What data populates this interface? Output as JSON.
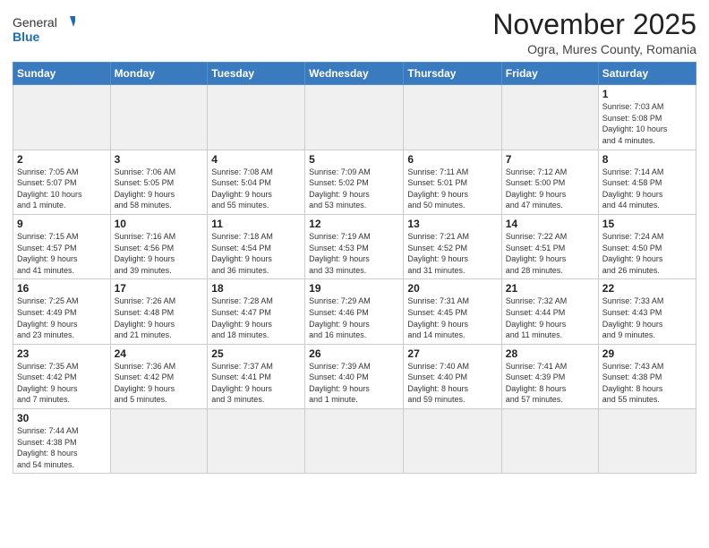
{
  "header": {
    "logo_general": "General",
    "logo_blue": "Blue",
    "title": "November 2025",
    "subtitle": "Ogra, Mures County, Romania"
  },
  "weekdays": [
    "Sunday",
    "Monday",
    "Tuesday",
    "Wednesday",
    "Thursday",
    "Friday",
    "Saturday"
  ],
  "weeks": [
    [
      {
        "num": "",
        "info": ""
      },
      {
        "num": "",
        "info": ""
      },
      {
        "num": "",
        "info": ""
      },
      {
        "num": "",
        "info": ""
      },
      {
        "num": "",
        "info": ""
      },
      {
        "num": "",
        "info": ""
      },
      {
        "num": "1",
        "info": "Sunrise: 7:03 AM\nSunset: 5:08 PM\nDaylight: 10 hours\nand 4 minutes."
      }
    ],
    [
      {
        "num": "2",
        "info": "Sunrise: 7:05 AM\nSunset: 5:07 PM\nDaylight: 10 hours\nand 1 minute."
      },
      {
        "num": "3",
        "info": "Sunrise: 7:06 AM\nSunset: 5:05 PM\nDaylight: 9 hours\nand 58 minutes."
      },
      {
        "num": "4",
        "info": "Sunrise: 7:08 AM\nSunset: 5:04 PM\nDaylight: 9 hours\nand 55 minutes."
      },
      {
        "num": "5",
        "info": "Sunrise: 7:09 AM\nSunset: 5:02 PM\nDaylight: 9 hours\nand 53 minutes."
      },
      {
        "num": "6",
        "info": "Sunrise: 7:11 AM\nSunset: 5:01 PM\nDaylight: 9 hours\nand 50 minutes."
      },
      {
        "num": "7",
        "info": "Sunrise: 7:12 AM\nSunset: 5:00 PM\nDaylight: 9 hours\nand 47 minutes."
      },
      {
        "num": "8",
        "info": "Sunrise: 7:14 AM\nSunset: 4:58 PM\nDaylight: 9 hours\nand 44 minutes."
      }
    ],
    [
      {
        "num": "9",
        "info": "Sunrise: 7:15 AM\nSunset: 4:57 PM\nDaylight: 9 hours\nand 41 minutes."
      },
      {
        "num": "10",
        "info": "Sunrise: 7:16 AM\nSunset: 4:56 PM\nDaylight: 9 hours\nand 39 minutes."
      },
      {
        "num": "11",
        "info": "Sunrise: 7:18 AM\nSunset: 4:54 PM\nDaylight: 9 hours\nand 36 minutes."
      },
      {
        "num": "12",
        "info": "Sunrise: 7:19 AM\nSunset: 4:53 PM\nDaylight: 9 hours\nand 33 minutes."
      },
      {
        "num": "13",
        "info": "Sunrise: 7:21 AM\nSunset: 4:52 PM\nDaylight: 9 hours\nand 31 minutes."
      },
      {
        "num": "14",
        "info": "Sunrise: 7:22 AM\nSunset: 4:51 PM\nDaylight: 9 hours\nand 28 minutes."
      },
      {
        "num": "15",
        "info": "Sunrise: 7:24 AM\nSunset: 4:50 PM\nDaylight: 9 hours\nand 26 minutes."
      }
    ],
    [
      {
        "num": "16",
        "info": "Sunrise: 7:25 AM\nSunset: 4:49 PM\nDaylight: 9 hours\nand 23 minutes."
      },
      {
        "num": "17",
        "info": "Sunrise: 7:26 AM\nSunset: 4:48 PM\nDaylight: 9 hours\nand 21 minutes."
      },
      {
        "num": "18",
        "info": "Sunrise: 7:28 AM\nSunset: 4:47 PM\nDaylight: 9 hours\nand 18 minutes."
      },
      {
        "num": "19",
        "info": "Sunrise: 7:29 AM\nSunset: 4:46 PM\nDaylight: 9 hours\nand 16 minutes."
      },
      {
        "num": "20",
        "info": "Sunrise: 7:31 AM\nSunset: 4:45 PM\nDaylight: 9 hours\nand 14 minutes."
      },
      {
        "num": "21",
        "info": "Sunrise: 7:32 AM\nSunset: 4:44 PM\nDaylight: 9 hours\nand 11 minutes."
      },
      {
        "num": "22",
        "info": "Sunrise: 7:33 AM\nSunset: 4:43 PM\nDaylight: 9 hours\nand 9 minutes."
      }
    ],
    [
      {
        "num": "23",
        "info": "Sunrise: 7:35 AM\nSunset: 4:42 PM\nDaylight: 9 hours\nand 7 minutes."
      },
      {
        "num": "24",
        "info": "Sunrise: 7:36 AM\nSunset: 4:42 PM\nDaylight: 9 hours\nand 5 minutes."
      },
      {
        "num": "25",
        "info": "Sunrise: 7:37 AM\nSunset: 4:41 PM\nDaylight: 9 hours\nand 3 minutes."
      },
      {
        "num": "26",
        "info": "Sunrise: 7:39 AM\nSunset: 4:40 PM\nDaylight: 9 hours\nand 1 minute."
      },
      {
        "num": "27",
        "info": "Sunrise: 7:40 AM\nSunset: 4:40 PM\nDaylight: 8 hours\nand 59 minutes."
      },
      {
        "num": "28",
        "info": "Sunrise: 7:41 AM\nSunset: 4:39 PM\nDaylight: 8 hours\nand 57 minutes."
      },
      {
        "num": "29",
        "info": "Sunrise: 7:43 AM\nSunset: 4:38 PM\nDaylight: 8 hours\nand 55 minutes."
      }
    ],
    [
      {
        "num": "30",
        "info": "Sunrise: 7:44 AM\nSunset: 4:38 PM\nDaylight: 8 hours\nand 54 minutes."
      },
      {
        "num": "",
        "info": ""
      },
      {
        "num": "",
        "info": ""
      },
      {
        "num": "",
        "info": ""
      },
      {
        "num": "",
        "info": ""
      },
      {
        "num": "",
        "info": ""
      },
      {
        "num": "",
        "info": ""
      }
    ]
  ]
}
